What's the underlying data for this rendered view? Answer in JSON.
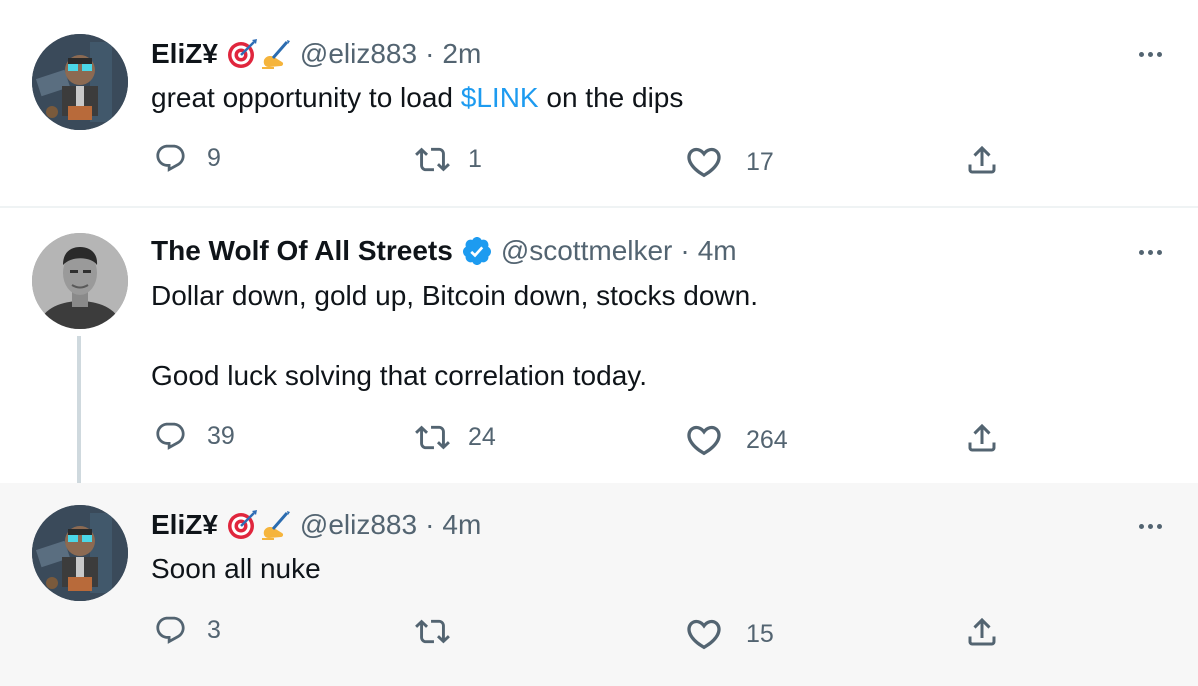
{
  "colors": {
    "accent": "#1d9bf0",
    "muted": "#536471",
    "text": "#0f1419",
    "highlight_bg": "#f7f7f7"
  },
  "tweets": [
    {
      "name": "EliZ¥",
      "emojis": [
        "direct-hit-emoji",
        "writing-hand-emoji"
      ],
      "handle": "@eliz883",
      "sep": "·",
      "time": "2m",
      "text_before": "great opportunity to load ",
      "cashtag": "$LINK",
      "text_after": " on the dips",
      "replies": "9",
      "retweets": "1",
      "likes": "17"
    },
    {
      "name": "The Wolf Of All Streets",
      "verified": true,
      "handle": "@scottmelker",
      "sep": "·",
      "time": "4m",
      "line1": "Dollar down, gold up, Bitcoin down, stocks down.",
      "line2": "Good luck solving that correlation today.",
      "replies": "39",
      "retweets": "24",
      "likes": "264"
    },
    {
      "name": "EliZ¥",
      "emojis": [
        "direct-hit-emoji",
        "writing-hand-emoji"
      ],
      "handle": "@eliz883",
      "sep": "·",
      "time": "4m",
      "text": "Soon all nuke",
      "replies": "3",
      "retweets": "",
      "likes": "15"
    }
  ]
}
